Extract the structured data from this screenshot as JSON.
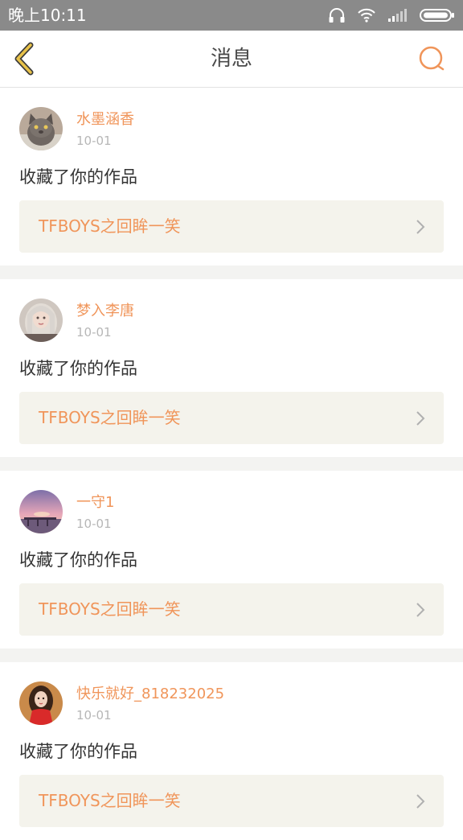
{
  "status_bar": {
    "time": "晚上10:11",
    "icons": [
      "headphones-icon",
      "wifi-icon",
      "signal-icon",
      "battery-icon"
    ]
  },
  "header": {
    "title": "消息",
    "back_icon": "chevron-left-icon",
    "search_icon": "search-icon"
  },
  "colors": {
    "accent": "#f0955a",
    "back_icon": "#e8c24a",
    "status_bar_bg": "#8a8a8a",
    "card_link_bg": "#f4f3ec",
    "divider_bg": "#f3f3f1"
  },
  "messages": [
    {
      "username": "水墨涵香",
      "date": "10-01",
      "action": "收藏了你的作品",
      "work_title": "TFBOYS之回眸一笑"
    },
    {
      "username": "梦入李唐",
      "date": "10-01",
      "action": "收藏了你的作品",
      "work_title": "TFBOYS之回眸一笑"
    },
    {
      "username": "一守1",
      "date": "10-01",
      "action": "收藏了你的作品",
      "work_title": "TFBOYS之回眸一笑"
    },
    {
      "username": "快乐就好_818232025",
      "date": "10-01",
      "action": "收藏了你的作品",
      "work_title": "TFBOYS之回眸一笑"
    }
  ]
}
